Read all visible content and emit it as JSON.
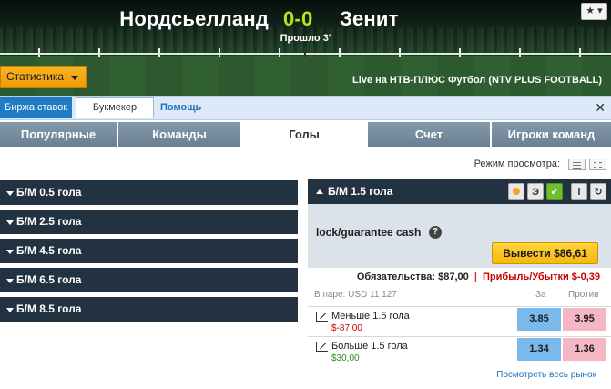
{
  "match": {
    "home_team": "Нордсьелланд",
    "away_team": "Зенит",
    "score": "0-0",
    "elapsed": "Прошло 3'",
    "favorite_icon": "star-icon",
    "favorite_glyph": "★ ▾"
  },
  "header": {
    "stats_label": "Статистика",
    "live_label": "Live на НТВ-ПЛЮС Футбол (NTV PLUS FOOTBALL)"
  },
  "subnav": {
    "exchange_label": "Биржа ставок",
    "bookmaker_label": "Букмекер",
    "help_label": "Помощь",
    "close_glyph": "✕"
  },
  "category_tabs": [
    {
      "label": "Популярные",
      "active": false
    },
    {
      "label": "Команды",
      "active": false
    },
    {
      "label": "Голы",
      "active": true
    },
    {
      "label": "Счет",
      "active": false
    },
    {
      "label": "Игроки команд",
      "active": false
    }
  ],
  "view_mode": {
    "label": "Режим просмотра:"
  },
  "markets_left": [
    {
      "label": "Б/М 0.5 гола"
    },
    {
      "label": "Б/М 2.5 гола"
    },
    {
      "label": "Б/М 4.5 гола"
    },
    {
      "label": "Б/М 6.5 гола"
    },
    {
      "label": "Б/М 8.5 гола"
    }
  ],
  "market_panel": {
    "title": "Б/М 1.5 гола",
    "icons": {
      "e_label": "Э",
      "check_label": "✔",
      "info_label": "i",
      "refresh_label": "↻"
    },
    "lock_text": "lock/guarantee cash",
    "help_glyph": "?",
    "cashout_label": "Вывести $86,61",
    "liability_text": "Обязательства: $87,00",
    "separator": "|",
    "pnl_text": "Прибыль/Убытки $-0,39",
    "matched_text": "В паре: USD 11 127",
    "back_header": "За",
    "lay_header": "Против",
    "runners": [
      {
        "name": "Меньше 1.5 гола",
        "pl": "$-87,00",
        "pl_sign": "neg",
        "back": "3.85",
        "lay": "3.95"
      },
      {
        "name": "Больше 1.5 гола",
        "pl": "$30,00",
        "pl_sign": "pos",
        "back": "1.34",
        "lay": "1.36"
      }
    ],
    "see_market_link": "Посмотреть весь рынок"
  },
  "colors": {
    "accent_orange": "#f7b80b",
    "dark_bar": "#233241",
    "back_blue": "#7ab9ec",
    "lay_pink": "#f5b7c3",
    "score_green": "#b8e31a",
    "link_blue": "#1b73be"
  }
}
